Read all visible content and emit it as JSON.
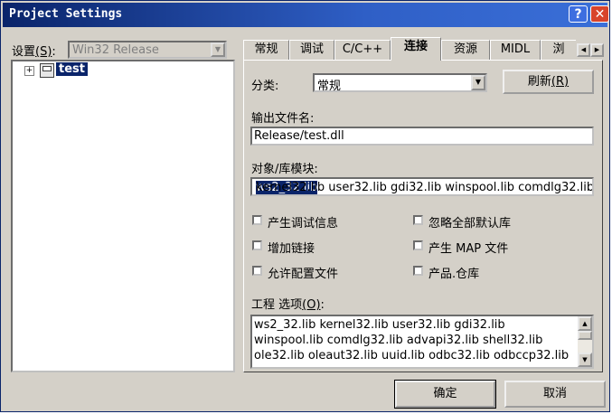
{
  "window": {
    "title": "Project Settings",
    "help_glyph": "?",
    "close_glyph": "✕"
  },
  "left": {
    "settings_label": "设置",
    "settings_key": "(S)",
    "settings_colon": ":",
    "config_value": "Win32 Release",
    "tree_expand": "+",
    "tree_item": "test"
  },
  "tabs": {
    "items": [
      "常规",
      "调试",
      "C/C++",
      "连接",
      "资源",
      "MIDL",
      "浏"
    ],
    "active_index": 3,
    "scroll_left": "◀",
    "scroll_right": "▶"
  },
  "panel": {
    "category_label": "分类:",
    "category_value": "常规",
    "refresh_label": "刷新",
    "refresh_key": "(R)",
    "output_label": "输出文件名:",
    "output_value": "Release/test.dll",
    "modules_label": "对象/库模块:",
    "modules_selected": "ws2_32.lib",
    "modules_rest": " kernel32.lib user32.lib gdi32.lib winspool.lib comdlg32.lib",
    "checkboxes": {
      "gen_debug": "产生调试信息",
      "ignore_default": "忽略全部默认库",
      "incremental": "增加链接",
      "gen_map": "产生 MAP 文件",
      "enable_profile": "允许配置文件",
      "product_repo": "产品.仓库"
    },
    "options_label": "工程 选项",
    "options_key": "(O)",
    "options_colon": ":",
    "options_lines": [
      "ws2_32.lib kernel32.lib user32.lib gdi32.lib",
      "winspool.lib comdlg32.lib advapi32.lib shell32.lib",
      "ole32.lib oleaut32.lib uuid.lib odbc32.lib odbccp32.lib"
    ],
    "scroll_up": "▲",
    "scroll_down": "▼"
  },
  "footer": {
    "ok_label": "确定",
    "cancel_label": "取消"
  },
  "colors": {
    "title_bar": "#0a246a",
    "dialog_face": "#d4d0c8",
    "selection": "#0a246a"
  }
}
